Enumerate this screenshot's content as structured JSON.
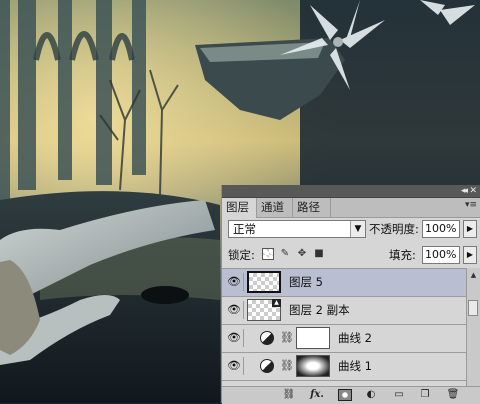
{
  "panel": {
    "tabs": [
      {
        "label": "图层",
        "active": true
      },
      {
        "label": "通道",
        "active": false
      },
      {
        "label": "路径",
        "active": false
      }
    ],
    "blend_mode": "正常",
    "opacity_label": "不透明度:",
    "opacity_value": "100%",
    "lock_label": "锁定:",
    "fill_label": "填充:",
    "fill_value": "100%",
    "layers": [
      {
        "name": "图层 5",
        "selected": true,
        "type": "pixel"
      },
      {
        "name": "图层 2 副本",
        "selected": false,
        "type": "pixel"
      },
      {
        "name": "曲线 2",
        "selected": false,
        "type": "adjustment"
      },
      {
        "name": "曲线 1",
        "selected": false,
        "type": "adjustment"
      }
    ],
    "bottom_tools": [
      "link-icon",
      "fx-icon",
      "mask-icon",
      "adjustment-icon",
      "folder-icon",
      "new-layer-icon",
      "trash-icon"
    ]
  },
  "icons": {
    "eye": "eye-icon",
    "chain": "chain-icon",
    "lock_transparent": "lock-transparent-icon",
    "lock_brush": "lock-pixels-icon",
    "lock_move": "lock-position-icon",
    "lock_all": "lock-all-icon"
  },
  "colors": {
    "panel_bg": "#d6d6d6",
    "selected_row": "#b9bfd0",
    "header_bar": "#585858"
  }
}
